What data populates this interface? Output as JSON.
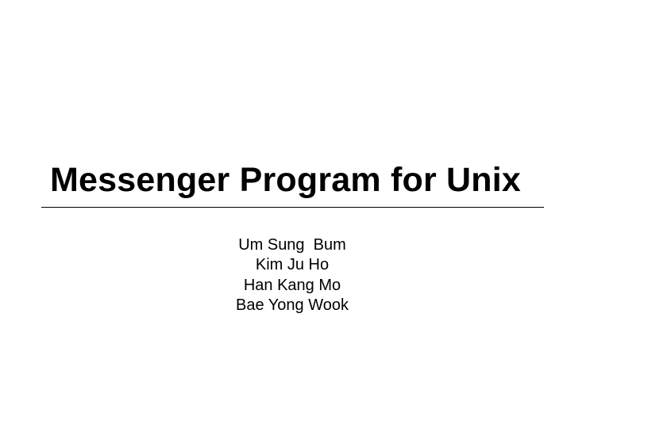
{
  "slide": {
    "title": "Messenger Program for Unix",
    "authors": [
      "Um Sung  Bum",
      "Kim Ju Ho",
      "Han Kang Mo",
      "Bae Yong Wook"
    ]
  }
}
